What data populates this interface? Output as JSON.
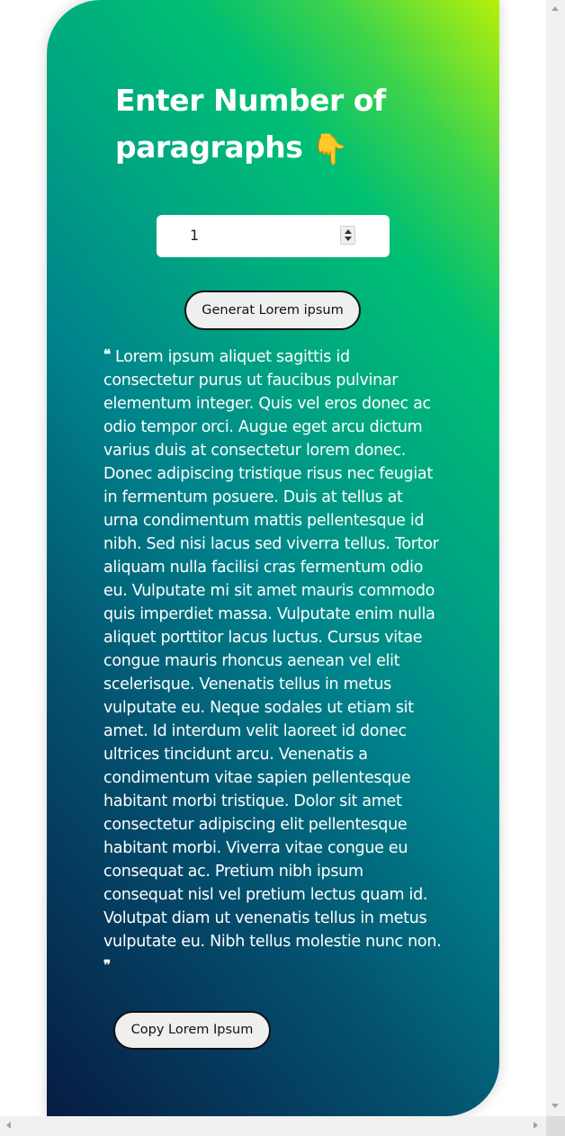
{
  "header": {
    "title": "Enter Number of paragraphs",
    "title_emoji": "👇"
  },
  "form": {
    "paragraph_count": "1",
    "generate_label": "Generat Lorem ipsum"
  },
  "output": {
    "open_quote": "❝",
    "text": "Lorem ipsum aliquet sagittis id consectetur purus ut faucibus pulvinar elementum integer. Quis vel eros donec ac odio tempor orci. Augue eget arcu dictum varius duis at consectetur lorem donec. Donec adipiscing tristique risus nec feugiat in fermentum posuere. Duis at tellus at urna condimentum mattis pellentesque id nibh. Sed nisi lacus sed viverra tellus. Tortor aliquam nulla facilisi cras fermentum odio eu. Vulputate mi sit amet mauris commodo quis imperdiet massa. Vulputate enim nulla aliquet porttitor lacus luctus. Cursus vitae congue mauris rhoncus aenean vel elit scelerisque. Venenatis tellus in metus vulputate eu. Neque sodales ut etiam sit amet. Id interdum velit laoreet id donec ultrices tincidunt arcu. Venenatis a condimentum vitae sapien pellentesque habitant morbi tristique. Dolor sit amet consectetur adipiscing elit pellentesque habitant morbi. Viverra vitae congue eu consequat ac. Pretium nibh ipsum consequat nisl vel pretium lectus quam id. Volutpat diam ut venenatis tellus in metus vulputate eu. Nibh tellus molestie nunc non.",
    "close_quote": "❞",
    "copy_label": "Copy Lorem Ipsum"
  },
  "icons": {
    "title_emoji": "backhand-index-pointing-down-icon",
    "spinner": "number-stepper-icon"
  },
  "colors": {
    "gradient_top_right": "#b5f00a",
    "gradient_green": "#00bf72",
    "gradient_teal": "#00838c",
    "gradient_bottom_left": "#071c43",
    "text": "#ffffff",
    "button_bg": "#efefef",
    "button_border": "#111111"
  }
}
